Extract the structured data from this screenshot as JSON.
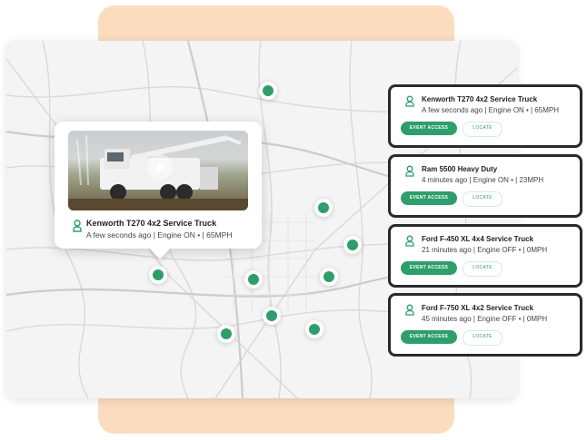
{
  "popup": {
    "title": "Kenworth T270 4x2 Service Truck",
    "status": "A few seconds ago | Engine ON • | 65MPH",
    "video_icon": "play-icon"
  },
  "vehicles": [
    {
      "title": "Kenworth T270 4x2 Service Truck",
      "status": "A few seconds ago | Engine ON • | 65MPH"
    },
    {
      "title": "Ram 5500 Heavy Duty",
      "status": "4 minutes ago | Engine ON • | 23MPH"
    },
    {
      "title": "Ford F-450 XL 4x4 Service Truck",
      "status": "21 minutes ago | Engine OFF • | 0MPH"
    },
    {
      "title": "Ford F-750 XL 4x2 Service Truck",
      "status": "45 minutes ago | Engine OFF • | 0MPH"
    }
  ],
  "buttons": {
    "event_access": "EVENT ACCESS",
    "locate": "LOCATE"
  },
  "colors": {
    "accent": "#2e9e6b",
    "peach": "#fcdcbf",
    "card_border": "#2a2a2a"
  },
  "icons": {
    "driver": "user-icon",
    "pin": "map-pin-dot"
  }
}
